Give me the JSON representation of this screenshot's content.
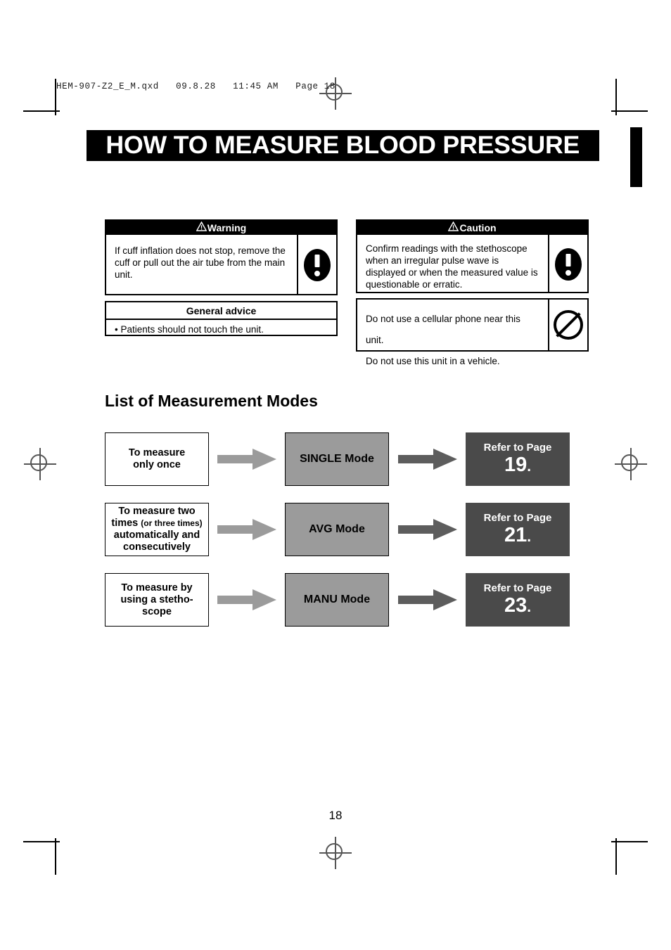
{
  "printers_mark_header": "HEM-907-Z2_E_M.qxd   09.8.28   11:45 AM   Page 18",
  "title": "HOW TO MEASURE BLOOD PRESSURE",
  "warning_box": {
    "header_symbol": "⚠",
    "header_label": "Warning",
    "text": "If cuff inflation does not stop, remove the cuff or pull out the air tube from the main unit.",
    "icon": "exclamation-circle-icon"
  },
  "general_advice_box": {
    "header_label": "General advice",
    "text": "• Patients should not touch the unit."
  },
  "caution_box": {
    "header_symbol": "⚠",
    "header_label": "Caution",
    "text": "Confirm readings with the stethoscope when an irregular pulse wave is displayed or when the measured value is questionable or erratic.",
    "icon": "exclamation-circle-icon"
  },
  "prohibition_box": {
    "line1": "Do not use a cellular phone near this unit.",
    "line2": "Do not use this unit in a vehicle.",
    "icon": "prohibition-icon"
  },
  "section_heading": "List of Measurement Modes",
  "flow_rows": [
    {
      "condition_line1": "To measure",
      "condition_line2": "only once",
      "condition_small": "",
      "condition_line3": "",
      "condition_line4": "",
      "mode": "SINGLE Mode",
      "page_label": "Refer to Page",
      "page_number": "19",
      "page_dot": "."
    },
    {
      "condition_line1": "To measure two",
      "condition_line2": "times",
      "condition_small": "(or three times)",
      "condition_line3": "automatically and",
      "condition_line4": "consecutively",
      "mode": "AVG Mode",
      "page_label": "Refer to Page",
      "page_number": "21",
      "page_dot": "."
    },
    {
      "condition_line1": "To measure by",
      "condition_line2": "using a stetho-",
      "condition_small": "",
      "condition_line3": "scope",
      "condition_line4": "",
      "mode": "MANU Mode",
      "page_label": "Refer to Page",
      "page_number": "23",
      "page_dot": "."
    }
  ],
  "page_number": "18",
  "colors": {
    "banner_background": "#000000",
    "banner_text": "#ffffff",
    "mode_box_fill": "#9b9b9b",
    "page_box_fill": "#4a4a4a",
    "arrow_light": "#9b9b9b",
    "arrow_dark": "#5d5d5d"
  }
}
